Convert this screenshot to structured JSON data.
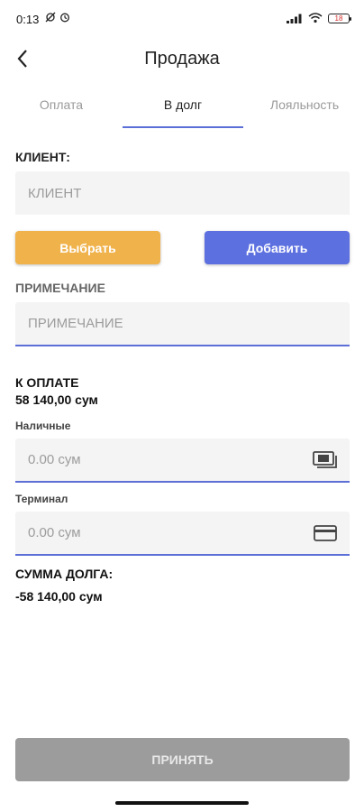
{
  "status_bar": {
    "time": "0:13",
    "battery": "18"
  },
  "header": {
    "title": "Продажа"
  },
  "tabs": [
    {
      "label": "Оплата",
      "active": false
    },
    {
      "label": "В долг",
      "active": true
    },
    {
      "label": "Лояльность",
      "active": false
    }
  ],
  "client": {
    "label": "КЛИЕНТ:",
    "placeholder": "КЛИЕНТ",
    "select_button": "Выбрать",
    "add_button": "Добавить"
  },
  "note": {
    "label": "ПРИМЕЧАНИЕ",
    "placeholder": "ПРИМЕЧАНИЕ"
  },
  "payment": {
    "to_pay_label": "К ОПЛАТЕ",
    "to_pay_amount": "58 140,00  сум",
    "cash_label": "Наличные",
    "cash_placeholder": "0.00 сум",
    "terminal_label": "Терминал",
    "terminal_placeholder": "0.00 сум"
  },
  "debt": {
    "label": "СУММА ДОЛГА:",
    "amount": "-58 140,00  сум"
  },
  "footer": {
    "accept_button": "ПРИНЯТЬ"
  },
  "colors": {
    "accent": "#5b6fd6",
    "select_button": "#f0b24a",
    "add_button": "#5d70e0",
    "accept_button_disabled": "#9c9c9c"
  },
  "icons": {
    "back": "chevron-left-icon",
    "cash": "cash-icon",
    "terminal": "credit-card-icon"
  }
}
